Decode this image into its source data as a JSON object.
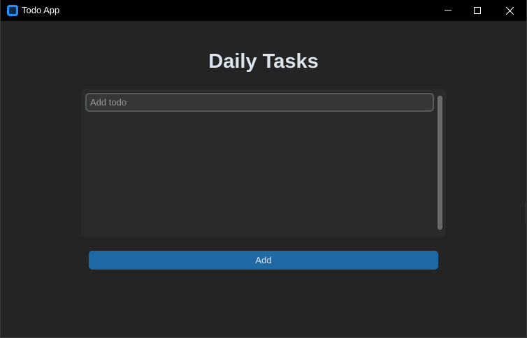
{
  "window": {
    "title": "Todo App",
    "controls": [
      "minimize-icon",
      "maximize-icon",
      "close-icon"
    ]
  },
  "main": {
    "heading": "Daily Tasks",
    "todo_input": {
      "placeholder": "Add todo",
      "value": ""
    },
    "add_button_label": "Add"
  },
  "colors": {
    "background": "#242424",
    "titlebar": "#000000",
    "frame": "#2b2b2b",
    "input_bg": "#343638",
    "input_border": "#565b5e",
    "accent": "#1f6aa5",
    "text": "#dce4ee"
  }
}
